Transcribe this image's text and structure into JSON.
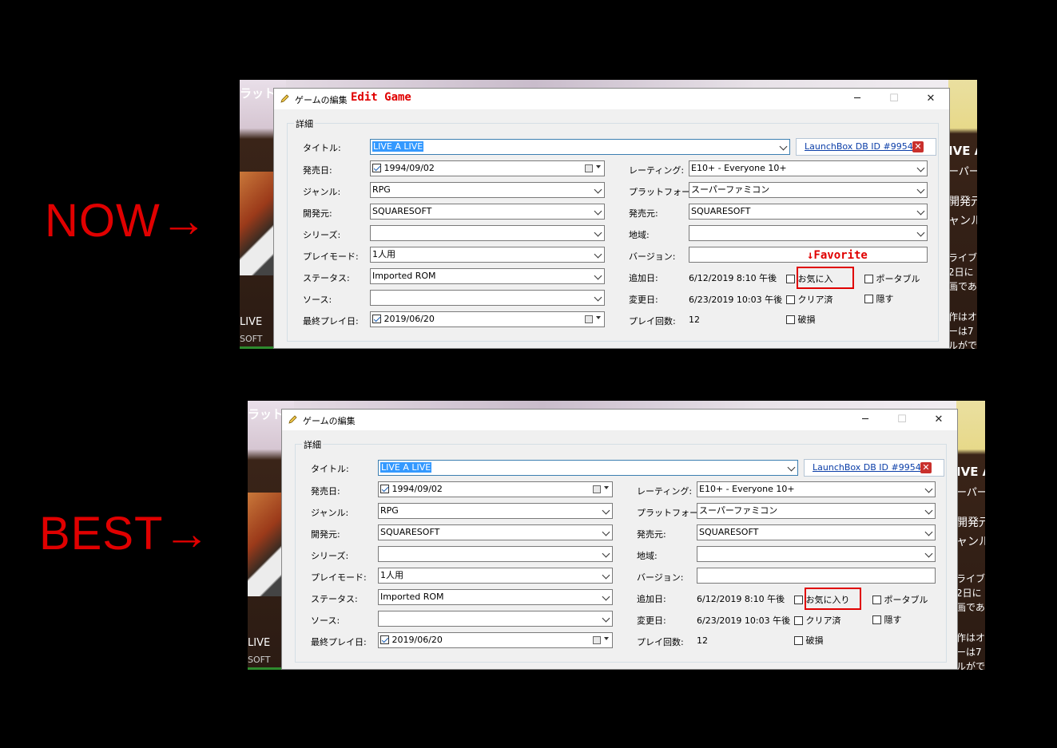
{
  "labels": {
    "now": "NOW→",
    "best": "BEST→"
  },
  "annotation": {
    "favorite": "↓Favorite",
    "edit_game": "Edit Game"
  },
  "bg": {
    "left_top": "ラット",
    "left_live": "LIVE",
    "left_soft": "SOFT",
    "right_lines": [
      "IVE A",
      "ーパーフ",
      "開発元",
      "ャンル",
      "ライブ・ア",
      "2日に",
      "画であ",
      "作はオ",
      "ーは7",
      "ルがで"
    ]
  },
  "dialog": {
    "title": "ゲームの編集",
    "group_title": "詳細",
    "title_label": "タイトル:",
    "title_value": "LIVE A LIVE",
    "launchbox_link": "LaunchBox DB ID #9954",
    "release_label": "発売日:",
    "release_value": "1994/09/02",
    "genre_label": "ジャンル:",
    "genre_value": "RPG",
    "developer_label": "開発元:",
    "developer_value": "SQUARESOFT",
    "series_label": "シリーズ:",
    "series_value": "",
    "playmode_label": "プレイモード:",
    "playmode_value": "1人用",
    "status_label": "ステータス:",
    "status_value": "Imported ROM",
    "source_label": "ソース:",
    "source_value": "",
    "lastplayed_label": "最終プレイ日:",
    "lastplayed_value": "2019/06/20",
    "rating_label": "レーティング:",
    "rating_value": "E10+ - Everyone 10+",
    "platform_label": "プラットフォーム",
    "platform_value": "スーパーファミコン",
    "publisher_label": "発売元:",
    "publisher_value": "SQUARESOFT",
    "region_label": "地域:",
    "region_value": "",
    "version_label": "バージョン:",
    "version_value": "",
    "added_label": "追加日:",
    "added_value": "6/12/2019 8:10 午後",
    "modified_label": "変更日:",
    "modified_value": "6/23/2019 10:03 午後",
    "playcount_label": "プレイ回数:",
    "playcount_value": "12",
    "favorite_now": "お気に入",
    "favorite_best": "お気に入り",
    "completed": "クリア済",
    "broken": "破損",
    "portable": "ポータブル",
    "hide": "隠す"
  }
}
